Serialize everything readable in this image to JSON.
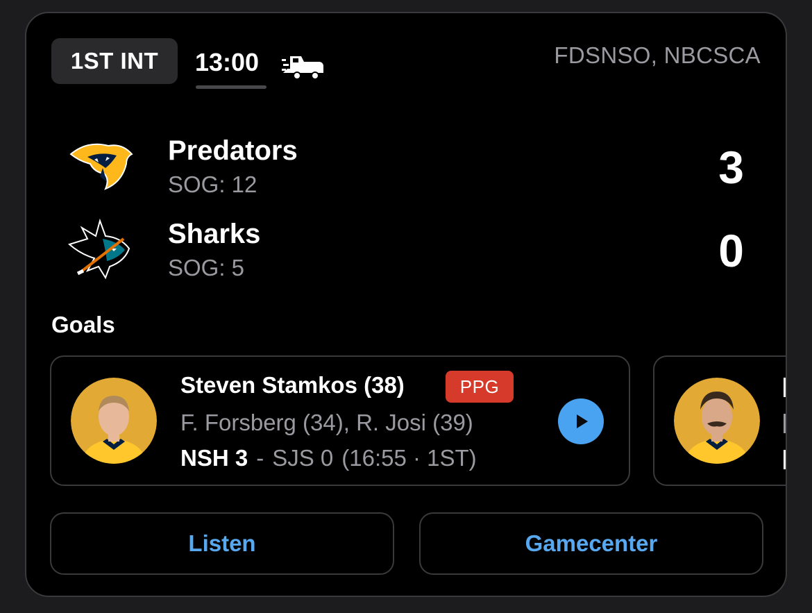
{
  "game": {
    "period": "1ST INT",
    "clock": "13:00",
    "broadcast": "FDSNSO, NBCSCA",
    "intermission_icon": "zamboni-icon"
  },
  "teams": [
    {
      "name": "Predators",
      "sog": "SOG: 12",
      "score": "3",
      "logo": "predators-logo"
    },
    {
      "name": "Sharks",
      "sog": "SOG: 5",
      "score": "0",
      "logo": "sharks-logo"
    }
  ],
  "goals": {
    "heading": "Goals",
    "items": [
      {
        "scorer": "Steven Stamkos (38)",
        "badge": "PPG",
        "assists": "F. Forsberg (34), R. Josi (39)",
        "home_score": "NSH 3",
        "separator": "-",
        "away_score": "SJS 0",
        "time": "(16:55 · 1ST)",
        "play_icon": "play-icon"
      }
    ]
  },
  "actions": {
    "listen": "Listen",
    "gamecenter": "Gamecenter"
  },
  "colors": {
    "background": "#000000",
    "accent": "#58a8f0",
    "ppg_badge": "#d63a2a",
    "muted_text": "#9a9aa0"
  }
}
